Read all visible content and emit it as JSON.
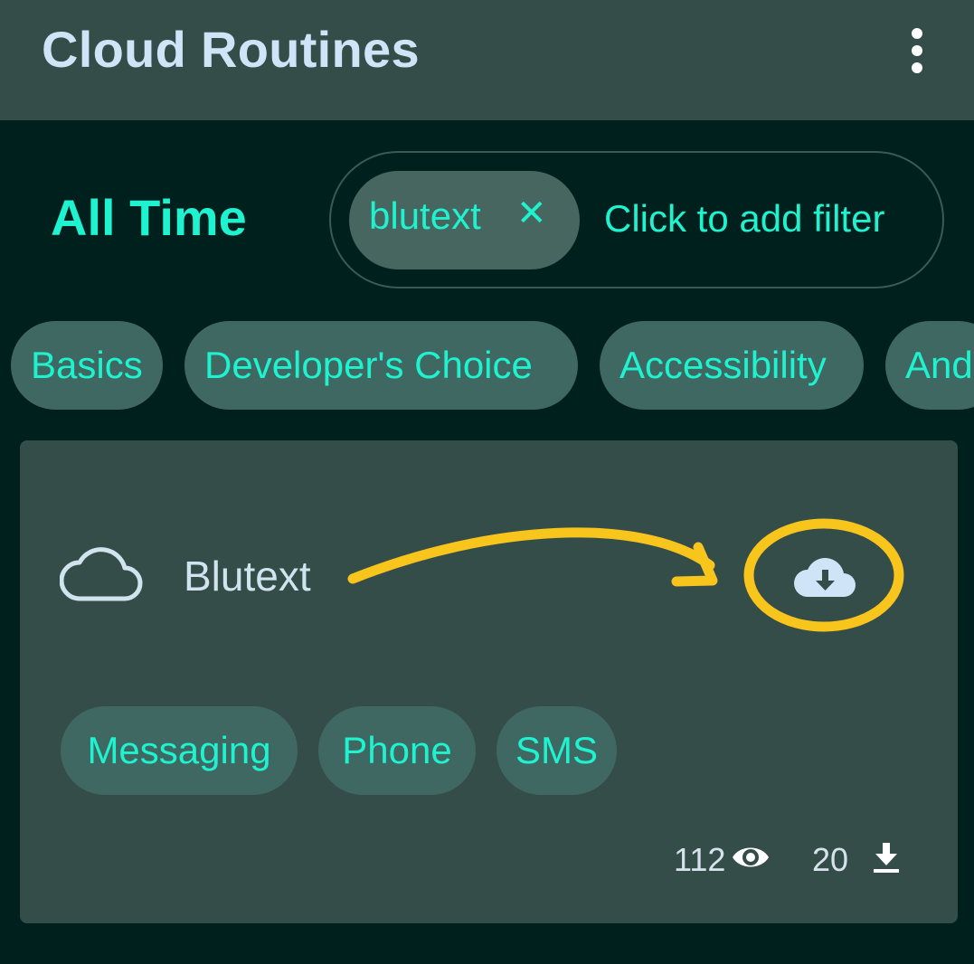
{
  "app": {
    "title": "Cloud Routines"
  },
  "filters": {
    "range": "All Time",
    "active_filter": "blutext",
    "remove_glyph": "✕",
    "add_placeholder": "Click to add filter"
  },
  "categories": [
    {
      "label": "Basics"
    },
    {
      "label": "Developer's Choice"
    },
    {
      "label": "Accessibility"
    },
    {
      "label": "And"
    }
  ],
  "routine": {
    "name": "Blutext",
    "tags": [
      "Messaging",
      "Phone",
      "SMS"
    ],
    "views": "112",
    "downloads": "20"
  },
  "icons": {
    "menu": "more-vert-icon",
    "cloud": "cloud-outline-icon",
    "download": "cloud-download-icon",
    "views": "eye-icon",
    "downloads": "download-icon"
  },
  "colors": {
    "accent": "#1ef2cf",
    "appbar": "#354d49",
    "background": "#00201e",
    "annotation": "#f8c51c"
  }
}
